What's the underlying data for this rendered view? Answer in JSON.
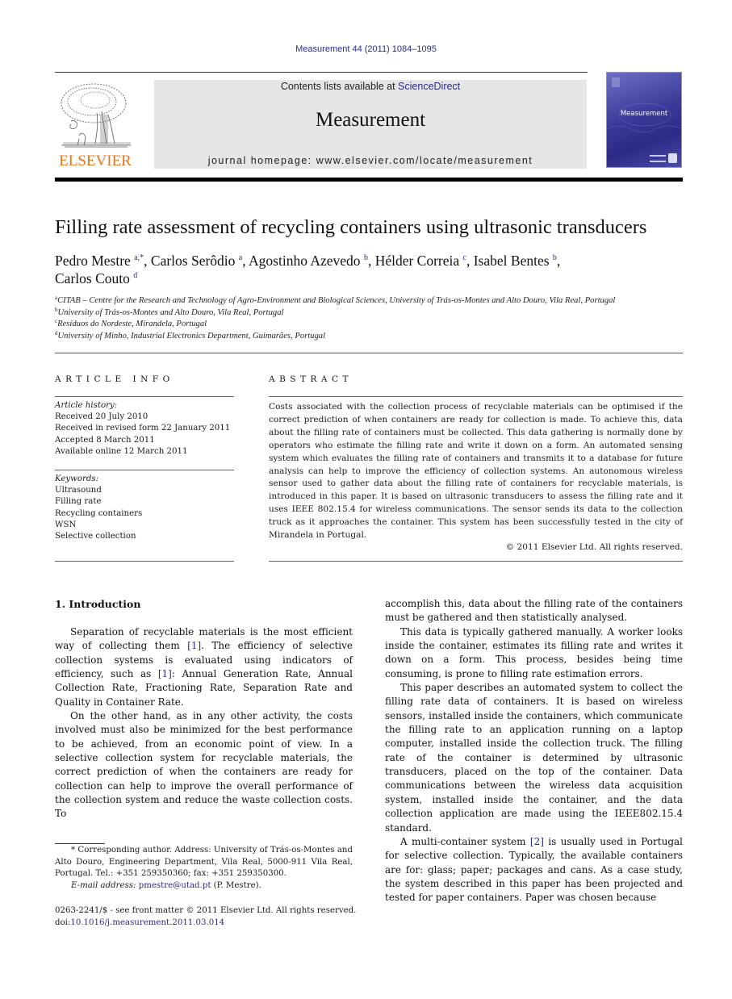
{
  "header": {
    "journal_ref": "Measurement 44 (2011) 1084–1095",
    "publisher_logo_text": "ELSEVIER",
    "contents_prefix": "Contents lists available at ",
    "contents_link": "ScienceDirect",
    "journal_name": "Measurement",
    "homepage": "journal homepage: www.elsevier.com/locate/measurement",
    "cover_title": "Measurement"
  },
  "colors": {
    "link": "#2a2a8c",
    "elsevier_orange": "#e8751a",
    "banner_bg": "#e6e6e6",
    "cover_blue": "#3b3a9a"
  },
  "article": {
    "title": "Filling rate assessment of recycling containers using ultrasonic transducers",
    "authors": [
      {
        "name": "Pedro Mestre",
        "sup": "a,*",
        "sep": ", "
      },
      {
        "name": "Carlos Serôdio",
        "sup": "a",
        "sep": ", "
      },
      {
        "name": "Agostinho Azevedo",
        "sup": "b",
        "sep": ", "
      },
      {
        "name": "Hélder Correia",
        "sup": "c",
        "sep": ", "
      },
      {
        "name": "Isabel Bentes",
        "sup": "b",
        "sep": ","
      },
      {
        "name": "Carlos Couto",
        "sup": "d",
        "sep": ""
      }
    ],
    "affiliations": [
      {
        "key": "a",
        "text": "CITAB – Centre for the Research and Technology of Agro-Environment and Biological Sciences, University of Trás-os-Montes and Alto Douro, Vila Real, Portugal"
      },
      {
        "key": "b",
        "text": "University of Trás-os-Montes and Alto Douro, Vila Real, Portugal"
      },
      {
        "key": "c",
        "text": "Resíduos do Nordeste, Mirandela, Portugal"
      },
      {
        "key": "d",
        "text": "University of Minho, Industrial Electronics Department, Guimarães, Portugal"
      }
    ]
  },
  "article_info": {
    "heading": "ARTICLE INFO",
    "history_label": "Article history:",
    "history": [
      "Received 20 July 2010",
      "Received in revised form 22 January 2011",
      "Accepted 8 March 2011",
      "Available online 12 March 2011"
    ],
    "keywords_label": "Keywords:",
    "keywords": [
      "Ultrasound",
      "Filling rate",
      "Recycling containers",
      "WSN",
      "Selective collection"
    ]
  },
  "abstract": {
    "heading": "ABSTRACT",
    "text": "Costs associated with the collection process of recyclable materials can be optimised if the correct prediction of when containers are ready for collection is made. To achieve this, data about the filling rate of containers must be collected. This data gathering is normally done by operators who estimate the filling rate and write it down on a form. An automated sensing system which evaluates the filling rate of containers and transmits it to a database for future analysis can help to improve the efficiency of collection systems. An autonomous wireless sensor used to gather data about the filling rate of containers for recyclable materials, is introduced in this paper. It is based on ultrasonic transducers to assess the filling rate and it uses IEEE 802.15.4 for wireless communications. The sensor sends its data to the collection truck as it approaches the container. This system has been successfully tested in the city of Mirandela in Portugal.",
    "copyright": "© 2011 Elsevier Ltd. All rights reserved."
  },
  "body": {
    "intro_heading": "1. Introduction",
    "left": {
      "p1_a": "Separation of recyclable materials is the most efficient way of collecting them ",
      "p1_ref1": "[1]",
      "p1_b": ". The efficiency of selective collection systems is evaluated using indicators of efficiency, such as ",
      "p1_ref2": "[1]",
      "p1_c": ": Annual Generation Rate, Annual Collection Rate, Fractioning Rate, Separation Rate and Quality in Container Rate.",
      "p2": "On the other hand, as in any other activity, the costs involved must also be minimized for the best performance to be achieved, from an economic point of view. In a selective collection system for recyclable materials, the correct prediction of when the containers are ready for collection can help to improve the overall performance of the collection system and reduce the waste collection costs. To"
    },
    "right": {
      "p0": "accomplish this, data about the filling rate of the containers must be gathered and then statistically analysed.",
      "p1": "This data is typically gathered manually. A worker looks inside the container, estimates its filling rate and writes it down on a form. This process, besides being time consuming, is prone to filling rate estimation errors.",
      "p2": "This paper describes an automated system to collect the filling rate data of containers. It is based on wireless sensors, installed inside the containers, which communicate the filling rate to an application running on a laptop computer, installed inside the collection truck. The filling rate of the container is determined by ultrasonic transducers, placed on the top of the container. Data communications between the wireless data acquisition system, installed inside the container, and the data collection application are made using the IEEE802.15.4 standard.",
      "p3_a": "A multi-container system ",
      "p3_ref": "[2]",
      "p3_b": " is usually used in Portugal for selective collection. Typically, the available containers are for: glass; paper; packages and cans. As a case study, the system described in this paper has been projected and tested for paper containers. Paper was chosen because"
    }
  },
  "footnote": {
    "corresponding": "* Corresponding author. Address: University of Trás-os-Montes and Alto Douro, Engineering Department, Vila Real, 5000-911 Vila Real, Portugal. Tel.: +351 259350360; fax: +351 259350300.",
    "email_label": "E-mail address: ",
    "email": "pmestre@utad.pt",
    "email_suffix": " (P. Mestre).",
    "front_matter": "0263-2241/$ - see front matter © 2011 Elsevier Ltd. All rights reserved.",
    "doi_label": "doi:",
    "doi": "10.1016/j.measurement.2011.03.014"
  }
}
